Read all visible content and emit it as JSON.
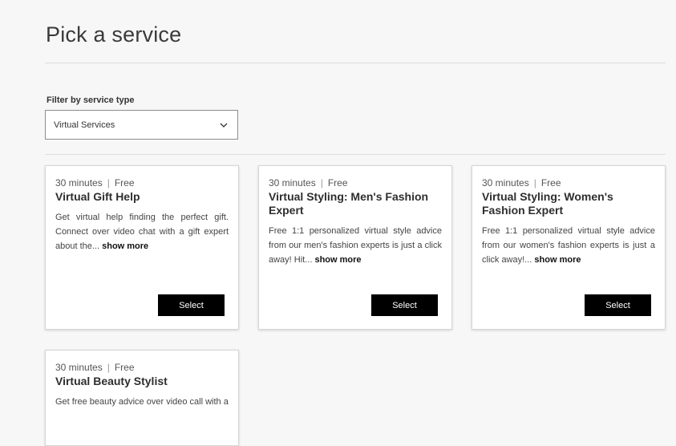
{
  "page": {
    "title": "Pick a service"
  },
  "filter": {
    "label": "Filter by service type",
    "selected": "Virtual Services"
  },
  "cards": [
    {
      "duration": "30 minutes",
      "separator": "|",
      "price": "Free",
      "title": "Virtual Gift Help",
      "description": "Get virtual help finding the perfect gift. Connect over video chat with a gift expert about the...",
      "more": "show more",
      "button": "Select"
    },
    {
      "duration": "30 minutes",
      "separator": "|",
      "price": "Free",
      "title": "Virtual Styling: Men's Fashion Expert",
      "description": "Free 1:1 personalized virtual style advice from our men's fashion experts is just a click away! Hit...",
      "more": "show more",
      "button": "Select"
    },
    {
      "duration": "30 minutes",
      "separator": "|",
      "price": "Free",
      "title": "Virtual Styling: Women's Fashion Expert",
      "description": "Free 1:1 personalized virtual style advice from our women's fashion experts is just a click away!...",
      "more": "show more",
      "button": "Select"
    },
    {
      "duration": "30 minutes",
      "separator": "|",
      "price": "Free",
      "title": "Virtual Beauty Stylist",
      "description": "Get free beauty advice over video call with a",
      "more": "",
      "button": ""
    }
  ]
}
